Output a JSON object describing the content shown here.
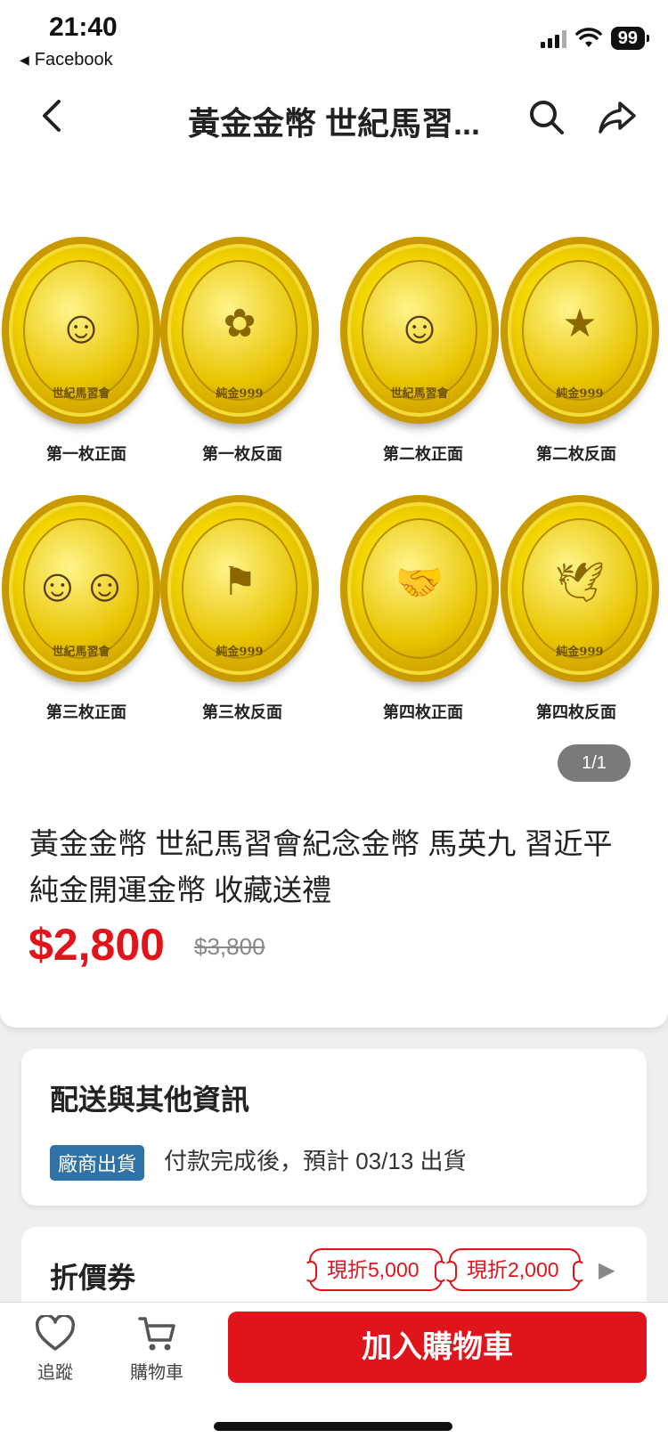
{
  "status_bar": {
    "time": "21:40",
    "back_app": "Facebook",
    "back_glyph": "◀",
    "battery": "99"
  },
  "nav": {
    "title": "黃金金幣 世紀馬習...",
    "back_icon": "chevron-left-icon",
    "search_icon": "search-icon",
    "share_icon": "share-icon"
  },
  "gallery": {
    "pager": "1/1",
    "coins": [
      {
        "label": "第一枚正面",
        "face": "portrait",
        "motif": "☺",
        "ring": "世紀馬習會"
      },
      {
        "label": "第一枚反面",
        "face": "emblem",
        "motif": "✿",
        "ring": "純金999"
      },
      {
        "label": "第二枚正面",
        "face": "portrait",
        "motif": "☺",
        "ring": "世紀馬習會"
      },
      {
        "label": "第二枚反面",
        "face": "emblem",
        "motif": "★",
        "ring": "純金999"
      },
      {
        "label": "第三枚正面",
        "face": "portrait",
        "motif": "☺☺",
        "ring": "世紀馬習會"
      },
      {
        "label": "第三枚反面",
        "face": "emblem",
        "motif": "⚑",
        "ring": "純金999"
      },
      {
        "label": "第四枚正面",
        "face": "emblem",
        "motif": "🤝",
        "ring": ""
      },
      {
        "label": "第四枚反面",
        "face": "emblem",
        "motif": "🕊",
        "ring": "純金999"
      }
    ]
  },
  "product": {
    "title": "黃金金幣 世紀馬習會紀念金幣 馬英九 習近平 純金開運金幣 收藏送禮",
    "price": "$2,800",
    "original_price": "$3,800",
    "price_color": "#e0141b"
  },
  "shipping": {
    "heading": "配送與其他資訊",
    "badge": "廠商出貨",
    "text": "付款完成後，預計 03/13 出貨"
  },
  "coupon": {
    "heading": "折價券",
    "tags": [
      "現折5,000",
      "現折2,000"
    ],
    "more_glyph": "▶"
  },
  "bottom": {
    "follow_label": "追蹤",
    "cart_label": "購物車",
    "add_to_cart": "加入購物車",
    "accent_color": "#e0141b"
  }
}
